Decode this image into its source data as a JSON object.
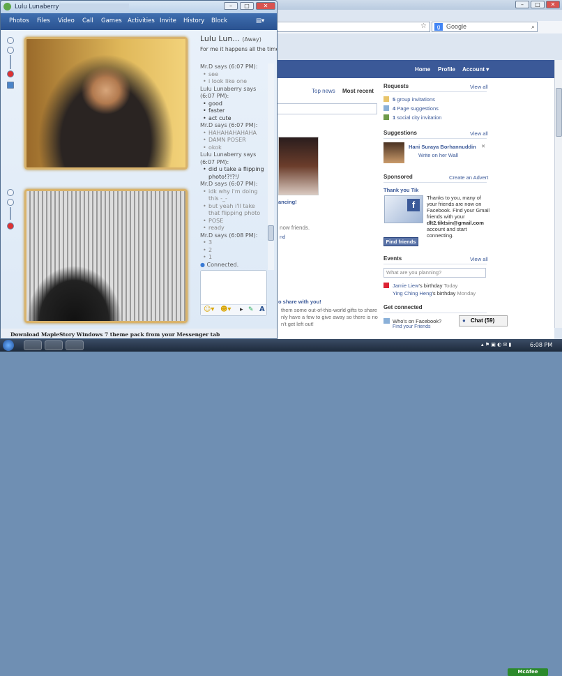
{
  "messenger": {
    "title": "Lulu Lunaberry",
    "menu": [
      "Photos",
      "Files",
      "Video",
      "Call",
      "Games",
      "Activities",
      "Invite",
      "History",
      "Block"
    ],
    "contact": {
      "name": "Lulu Lun...",
      "status": "(Away)",
      "message": "For me it happens all the time."
    },
    "chat": [
      {
        "who": "Mr.D says (6:07 PM):",
        "lines": [
          "see",
          "i look like one"
        ],
        "dim": true
      },
      {
        "who": "Lulu Lunaberry says (6:07 PM):",
        "lines": [
          "good",
          "faster",
          "act cute"
        ],
        "dim": false
      },
      {
        "who": "Mr.D says (6:07 PM):",
        "lines": [
          "HAHAHAHAHAHA",
          "DAMN POSER",
          "okok"
        ],
        "dim": true
      },
      {
        "who": "Lulu Lunaberry says (6:07 PM):",
        "lines": [
          "did u take a flipping photo!?!?!/"
        ],
        "dim": false
      },
      {
        "who": "Mr.D says (6:07 PM):",
        "lines": [
          "idk why i'm doing this -_-",
          "but yeah i'll take that flipping photo",
          "POSE",
          "ready"
        ],
        "dim": true
      },
      {
        "who": "Mr.D says (6:08 PM):",
        "lines": [
          "3",
          "2",
          "1"
        ],
        "dim": true
      }
    ],
    "connected": "Connected.",
    "footer": "Download MapleStory Windows 7 theme pack from your Messenger tab"
  },
  "browser": {
    "search_placeholder": "Google",
    "nav": [
      "Home",
      "Profile",
      "Account ▾"
    ],
    "news_tabs": [
      "Top news",
      "Most recent"
    ],
    "requests": {
      "title": "Requests",
      "view_all": "View all",
      "items": [
        {
          "count": "5",
          "label": "group invitations"
        },
        {
          "count": "4",
          "label": "Page suggestions"
        },
        {
          "count": "1",
          "label": "social city invitation"
        }
      ]
    },
    "suggestions": {
      "title": "Suggestions",
      "view_all": "View all",
      "name": "Hani Suraya Borhannuddin",
      "action": "Write on her Wall"
    },
    "sponsored": {
      "title": "Sponsored",
      "create": "Create an Advert",
      "ad_title": "Thank you Tik",
      "ad_text": [
        "Thanks to you, many of",
        "your friends are now on",
        "Facebook. Find your Gmail",
        "friends with your",
        "dlt2.tiktsin@gmail.com",
        "account and start",
        "connecting."
      ],
      "button": "Find friends"
    },
    "events": {
      "title": "Events",
      "view_all": "View all",
      "placeholder": "What are you planning?",
      "items": [
        {
          "name": "Jamie Liew",
          "suffix": "'s birthday",
          "when": "Today"
        },
        {
          "name": "Ying Ching Heng",
          "suffix": "'s birthday",
          "when": "Monday"
        }
      ]
    },
    "connected_title": "Get connected",
    "connected_item": "Who's on Facebook?",
    "connected_item2": "Find your Friends",
    "middle": {
      "link1": "ancing!",
      "text1": "now friends.",
      "link2": "nd",
      "share": "o share with you!",
      "share_text": [
        "them some out-of-this-world gifts to share",
        "nly have a few to give away so there is no",
        "n't get left out!"
      ]
    },
    "chat_bar": "Chat (59)"
  },
  "taskbar": {
    "time": "6:08 PM",
    "mcafee": "McAfee"
  },
  "colors": {
    "fb_blue": "#3b5998",
    "messenger_menu": "#2f5c9c",
    "cam_frame": "#d9b36b"
  }
}
